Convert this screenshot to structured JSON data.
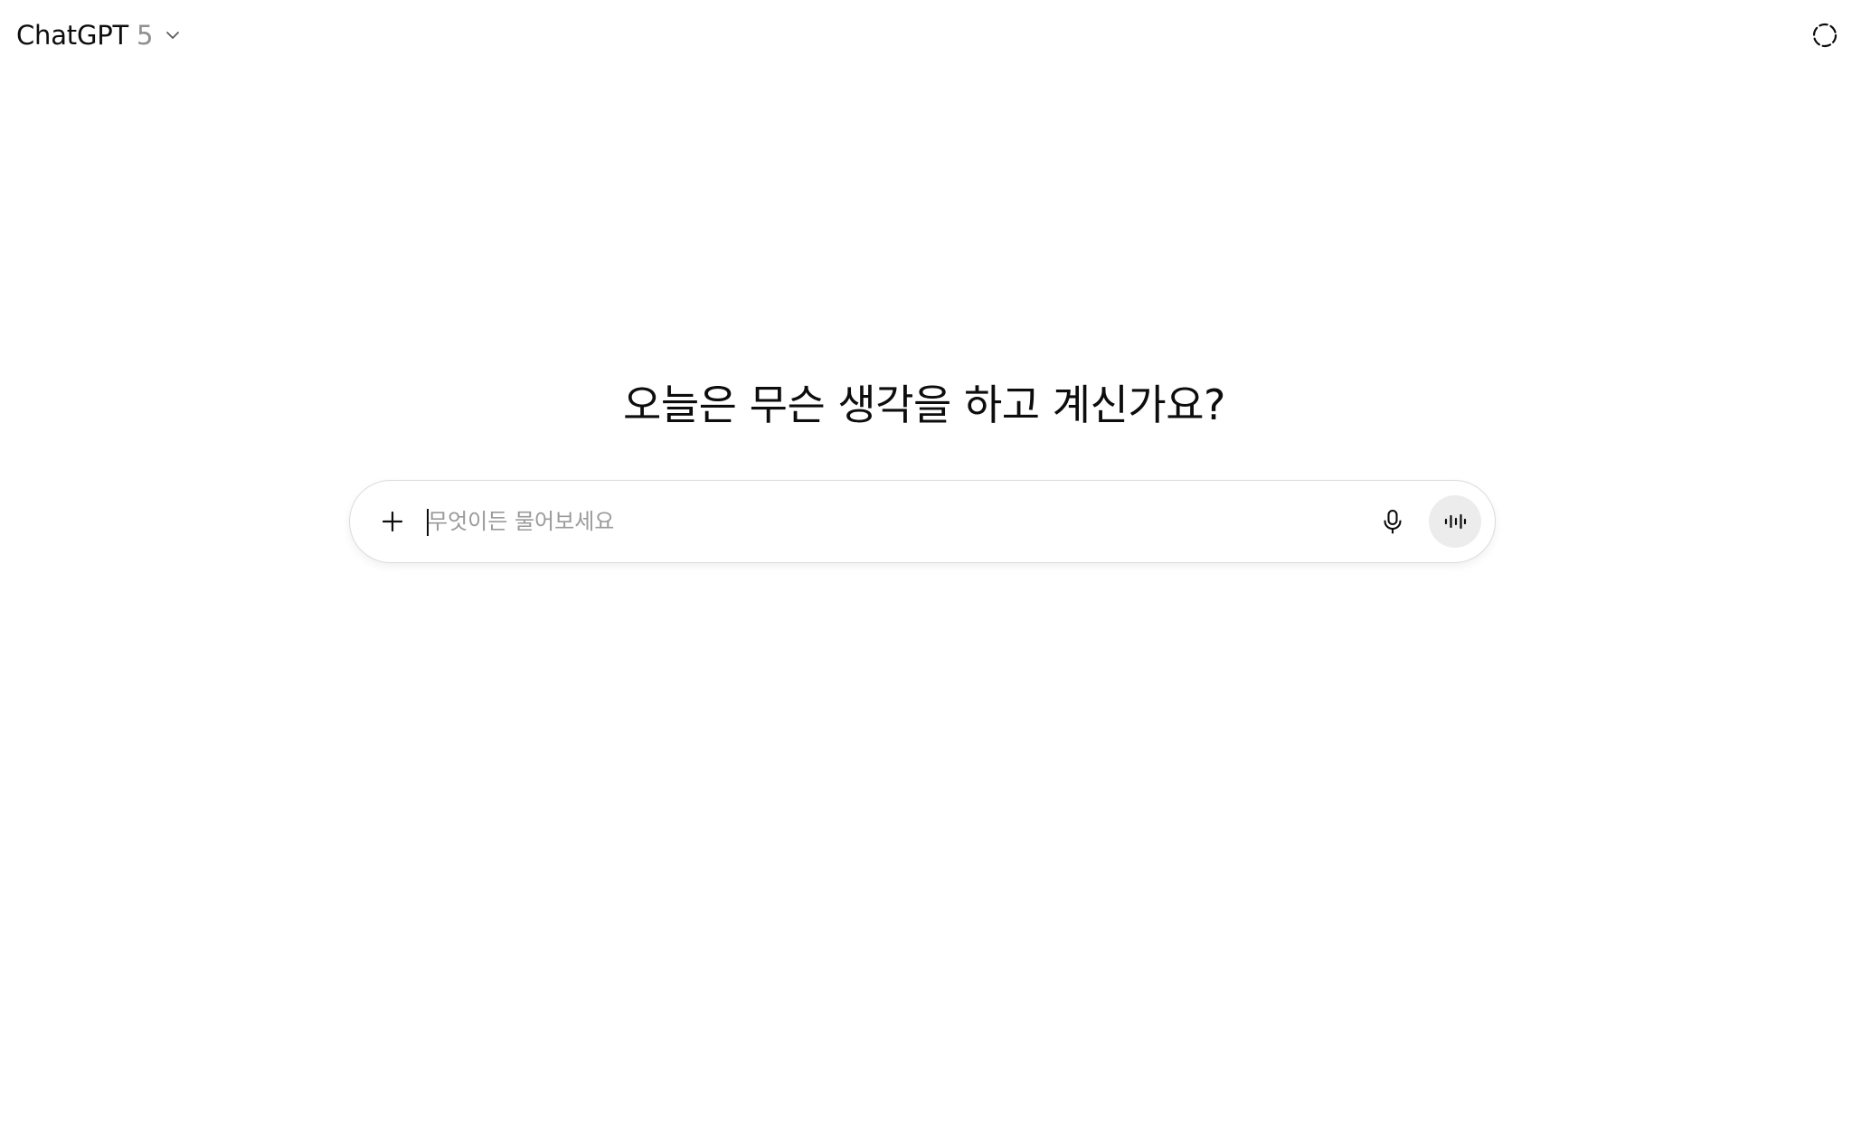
{
  "header": {
    "model_name": "ChatGPT",
    "model_version": "5",
    "model_dropdown_icon": "chevron-down-icon",
    "temporary_chat_icon": "dashed-circle-icon"
  },
  "main": {
    "greeting": "오늘은 무슨 생각을 하고 계신가요?"
  },
  "composer": {
    "placeholder": "무엇이든 물어보세요",
    "value": "",
    "add_icon": "plus-icon",
    "dictate_icon": "microphone-icon",
    "voice_mode_icon": "sound-wave-icon"
  },
  "colors": {
    "text_primary": "#0d0d0d",
    "text_muted": "#8f8f8f",
    "placeholder": "#9a9a9a",
    "composer_border": "#dcdcdc",
    "voice_button_bg": "#ececec",
    "background": "#ffffff"
  }
}
